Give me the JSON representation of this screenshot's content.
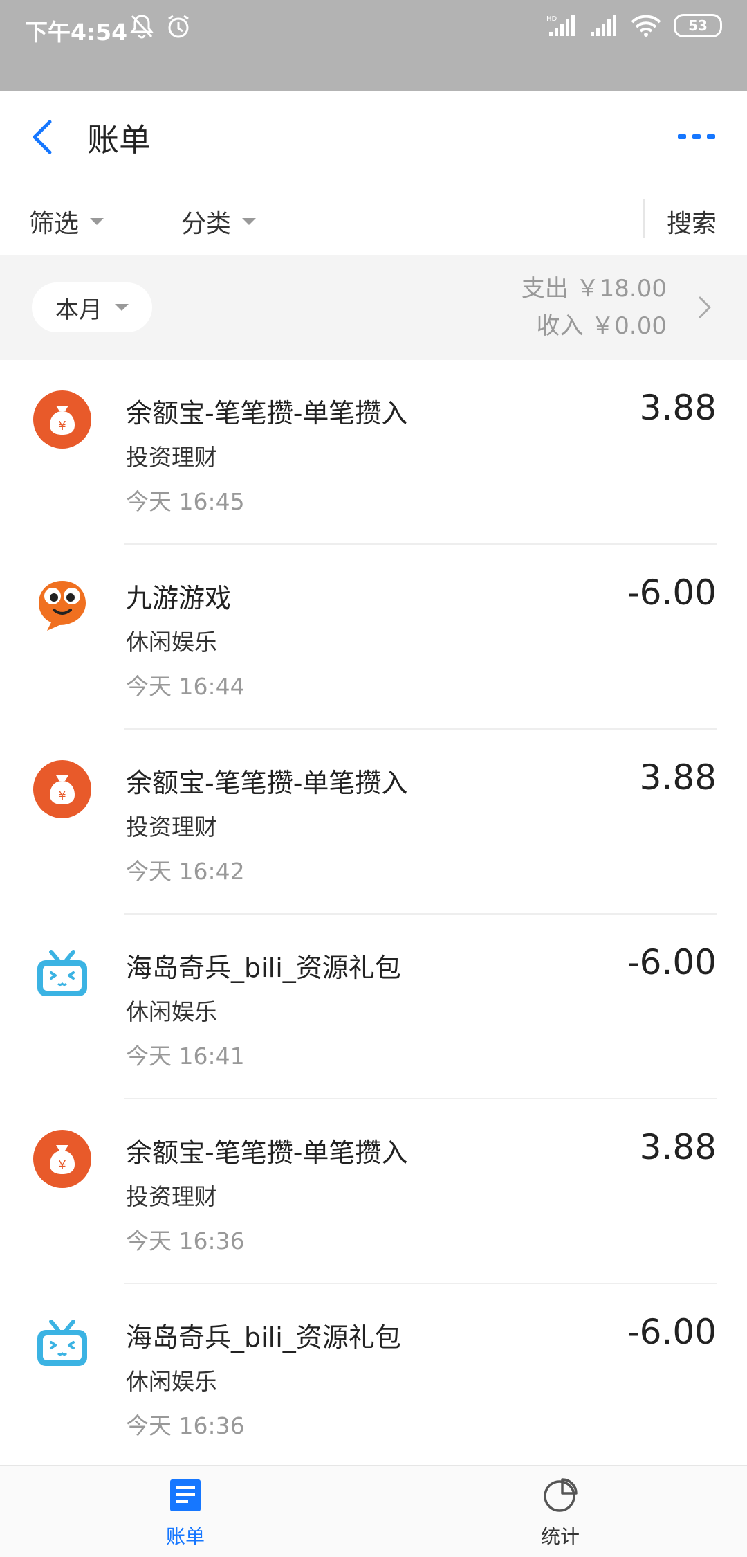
{
  "status": {
    "time": "下午4:54",
    "battery": "53",
    "hd": "HD"
  },
  "header": {
    "title": "账单"
  },
  "filters": {
    "filter": "筛选",
    "category": "分类",
    "search": "搜索"
  },
  "summary": {
    "month": "本月",
    "expense": "支出 ￥18.00",
    "income": "收入 ￥0.00"
  },
  "transactions": [
    {
      "name": "余额宝-笔笔攒-单笔攒入",
      "category": "投资理财",
      "time": "今天  16:45",
      "amount": "3.88",
      "icon": "money-bag-icon"
    },
    {
      "name": "九游游戏",
      "category": "休闲娱乐",
      "time": "今天  16:44",
      "amount": "-6.00",
      "icon": "jiuyou-mascot-icon"
    },
    {
      "name": "余额宝-笔笔攒-单笔攒入",
      "category": "投资理财",
      "time": "今天  16:42",
      "amount": "3.88",
      "icon": "money-bag-icon"
    },
    {
      "name": "海岛奇兵_bili_资源礼包",
      "category": "休闲娱乐",
      "time": "今天  16:41",
      "amount": "-6.00",
      "icon": "bilibili-tv-icon"
    },
    {
      "name": "余额宝-笔笔攒-单笔攒入",
      "category": "投资理财",
      "time": "今天  16:36",
      "amount": "3.88",
      "icon": "money-bag-icon"
    },
    {
      "name": "海岛奇兵_bili_资源礼包",
      "category": "休闲娱乐",
      "time": "今天  16:36",
      "amount": "-6.00",
      "icon": "bilibili-tv-icon"
    }
  ],
  "nav": {
    "bills": "账单",
    "stats": "统计"
  },
  "colors": {
    "accent": "#1677ff",
    "orange": "#e85a2a",
    "bili": "#3bb3e3"
  }
}
